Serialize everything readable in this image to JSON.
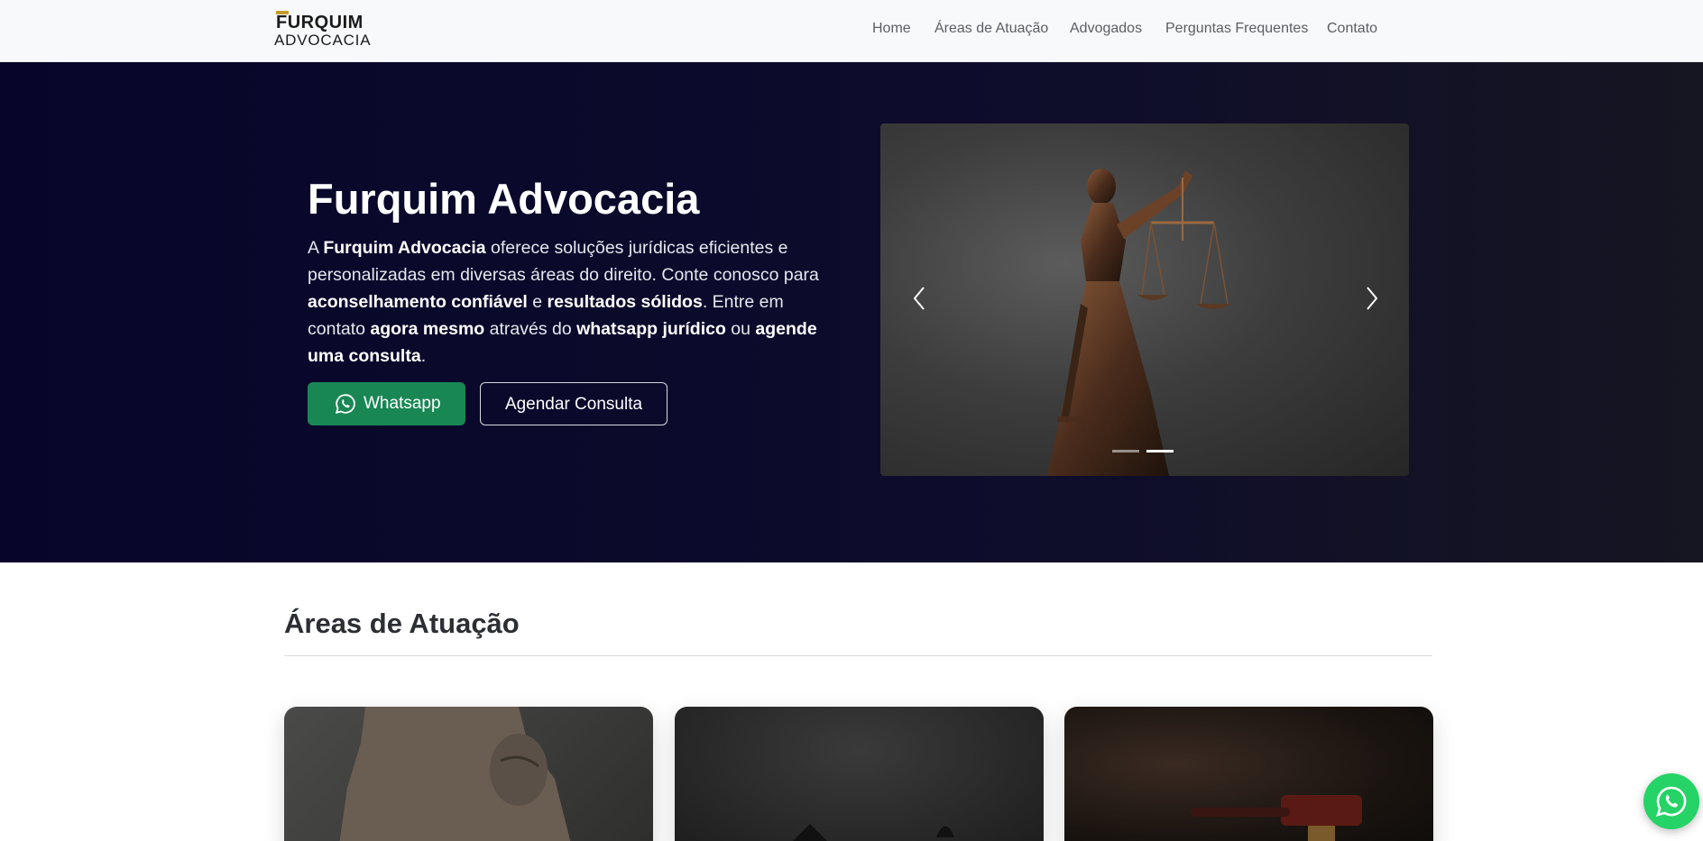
{
  "brand": {
    "line1": "FURQUIM",
    "line2": "ADVOCACIA"
  },
  "nav": {
    "items": [
      {
        "label": "Home"
      },
      {
        "label": "Áreas de Atuação"
      },
      {
        "label": "Advogados"
      },
      {
        "label": "Perguntas Frequentes"
      },
      {
        "label": "Contato"
      }
    ]
  },
  "hero": {
    "title": "Furquim Advocacia",
    "desc": {
      "p1": "A ",
      "b1": "Furquim Advocacia",
      "p2": " oferece soluções jurídicas eficientes e personalizadas em diversas áreas do direito. Conte conosco para ",
      "b2": "aconselhamento confiável",
      "p3": " e ",
      "b3": "resultados sólidos",
      "p4": ". Entre em contato ",
      "b4": "agora mesmo",
      "p5": " através do ",
      "b5": "whatsapp jurídico",
      "p6": " ou ",
      "b6": "agende uma consulta",
      "p7": "."
    },
    "whatsapp_label": "Whatsapp",
    "schedule_label": "Agendar Consulta"
  },
  "carousel": {
    "active_index": 2,
    "count": 2
  },
  "areas": {
    "title": "Áreas de Atuação"
  },
  "colors": {
    "hero_bg": "#07052a",
    "whatsapp_btn": "#198754",
    "whatsapp_fab": "#25d366",
    "navbar_bg": "#f8f9fa"
  },
  "icons": {
    "whatsapp": "whatsapp-icon",
    "prev": "chevron-left-icon",
    "next": "chevron-right-icon"
  }
}
